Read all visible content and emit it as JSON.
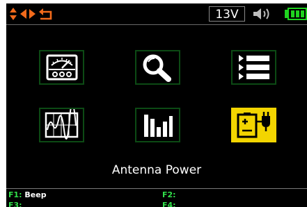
{
  "status_bar": {
    "voltage": "13V",
    "icons": [
      "up-down-arrows-icon",
      "left-arrow-icon",
      "right-arrow-icon",
      "return-icon",
      "speaker-icon",
      "battery-icon"
    ],
    "accent_color": "#f26a1b",
    "battery_color": "#1fd41f"
  },
  "menu": {
    "tiles": [
      {
        "icon": "analog-meter-icon"
      },
      {
        "icon": "magnifier-icon"
      },
      {
        "icon": "list-icon"
      },
      {
        "icon": "waveform-icon"
      },
      {
        "icon": "bar-graph-icon"
      },
      {
        "icon": "antenna-power-icon",
        "selected": true
      }
    ],
    "selected_label": "Antenna Power",
    "selected_color": "#f3d500",
    "tile_border_color": "#0c4a14"
  },
  "function_keys": {
    "f1_key": "F1:",
    "f1_label": "Beep",
    "f2_key": "F2:",
    "f2_label": "",
    "f3_key": "F3:",
    "f4_key": "F4:",
    "key_color": "#31e04a"
  }
}
